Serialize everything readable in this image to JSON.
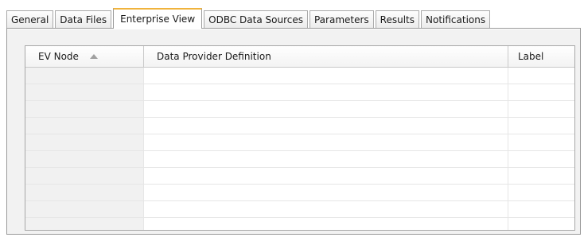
{
  "tabs": [
    {
      "label": "General",
      "active": false
    },
    {
      "label": "Data Files",
      "active": false
    },
    {
      "label": "Enterprise View",
      "active": true
    },
    {
      "label": "ODBC Data Sources",
      "active": false
    },
    {
      "label": "Parameters",
      "active": false
    },
    {
      "label": "Results",
      "active": false
    },
    {
      "label": "Notifications",
      "active": false
    }
  ],
  "table": {
    "columns": [
      {
        "label": "EV Node",
        "sorted": "ascending"
      },
      {
        "label": "Data Provider Definition"
      },
      {
        "label": "Label"
      }
    ],
    "rows": []
  },
  "icons": {
    "sort": "sort-ascending-icon"
  },
  "colors": {
    "active_tab_accent": "#f0b33c",
    "panel_bg": "#f2f2f2"
  }
}
